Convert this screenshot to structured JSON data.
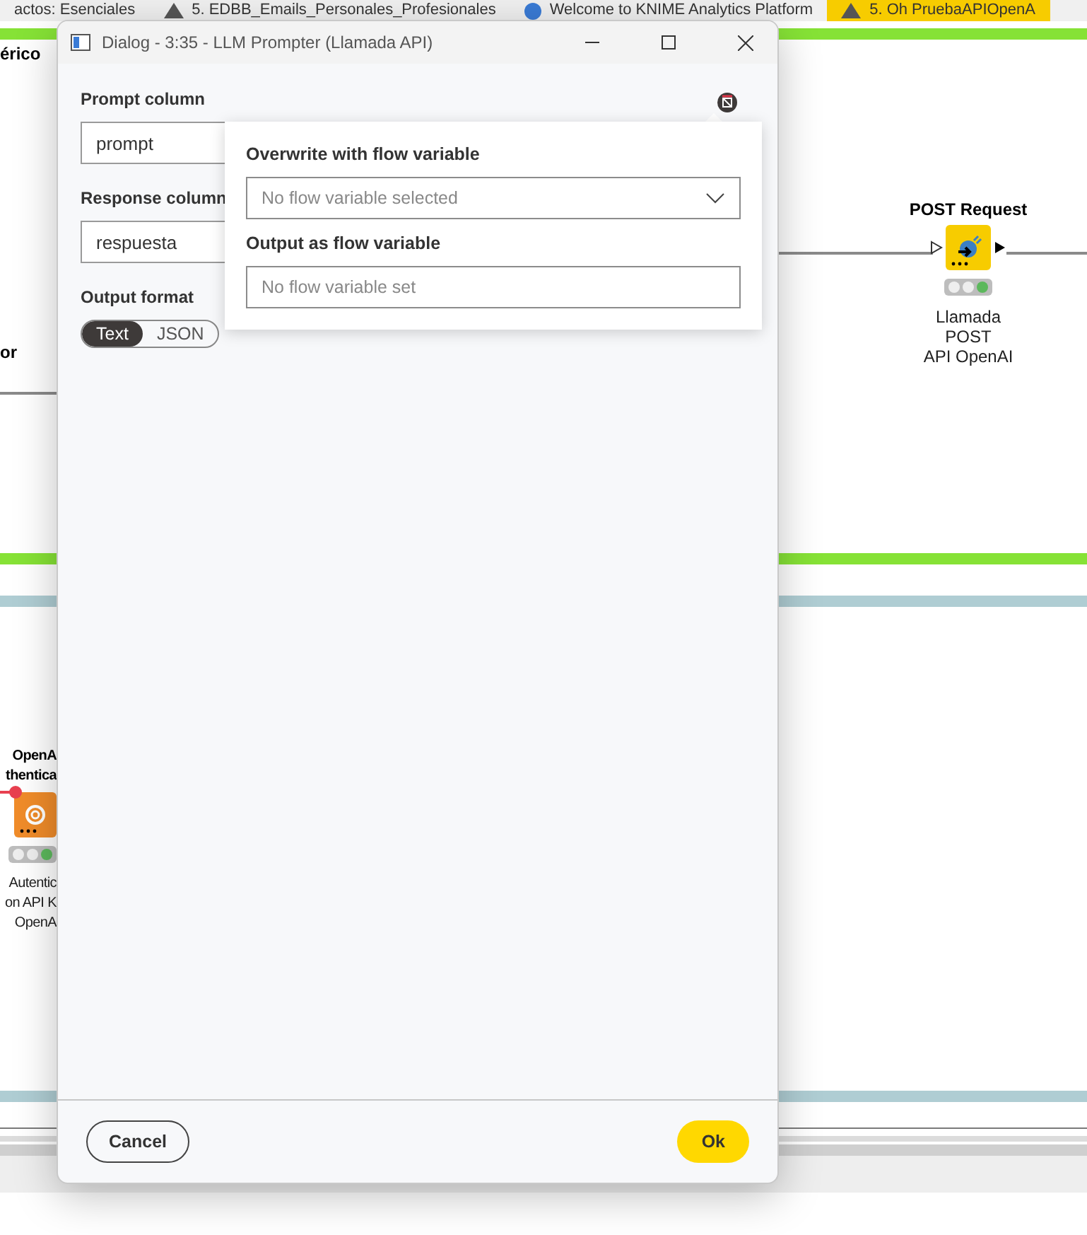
{
  "tabs": [
    {
      "label": "actos: Esenciales",
      "selected": false,
      "kind": "plain"
    },
    {
      "label": "5. EDBB_Emails_Personales_Profesionales",
      "selected": false,
      "kind": "workflow"
    },
    {
      "label": "Welcome to KNIME Analytics Platform",
      "selected": false,
      "kind": "web"
    },
    {
      "label": "5. Oh PruebaAPIOpenA",
      "selected": true,
      "kind": "workflow"
    }
  ],
  "canvas": {
    "labels": [
      "érico",
      "or"
    ],
    "nodes": [
      {
        "title_lines": [
          "POST Request"
        ],
        "name_lines": [
          "Llamada",
          "POST",
          "API OpenAI"
        ],
        "color": "#f7cc00",
        "lights": [
          false,
          false,
          true
        ],
        "kind": "post"
      },
      {
        "title_lines": [
          "OpenA",
          "thentica"
        ],
        "name_lines": [
          "Autentic",
          "on API K",
          "OpenA"
        ],
        "color": "#f08c2a",
        "lights": [
          false,
          false,
          true
        ],
        "kind": "auth"
      }
    ]
  },
  "dialog": {
    "title": "Dialog - 3:35 - LLM Prompter (Llamada API)",
    "fields": [
      {
        "label": "Prompt column",
        "value": "prompt"
      },
      {
        "label": "Response column",
        "value": "respuesta"
      }
    ],
    "format": {
      "label": "Output format",
      "options": [
        {
          "label": "Text",
          "selected": true
        },
        {
          "label": "JSON",
          "selected": false
        }
      ]
    },
    "popover": {
      "overwrite_label": "Overwrite with flow variable",
      "overwrite_placeholder": "No flow variable selected",
      "output_label": "Output as flow variable",
      "output_placeholder": "No flow variable set"
    },
    "buttons": {
      "cancel": "Cancel",
      "ok": "Ok"
    }
  }
}
